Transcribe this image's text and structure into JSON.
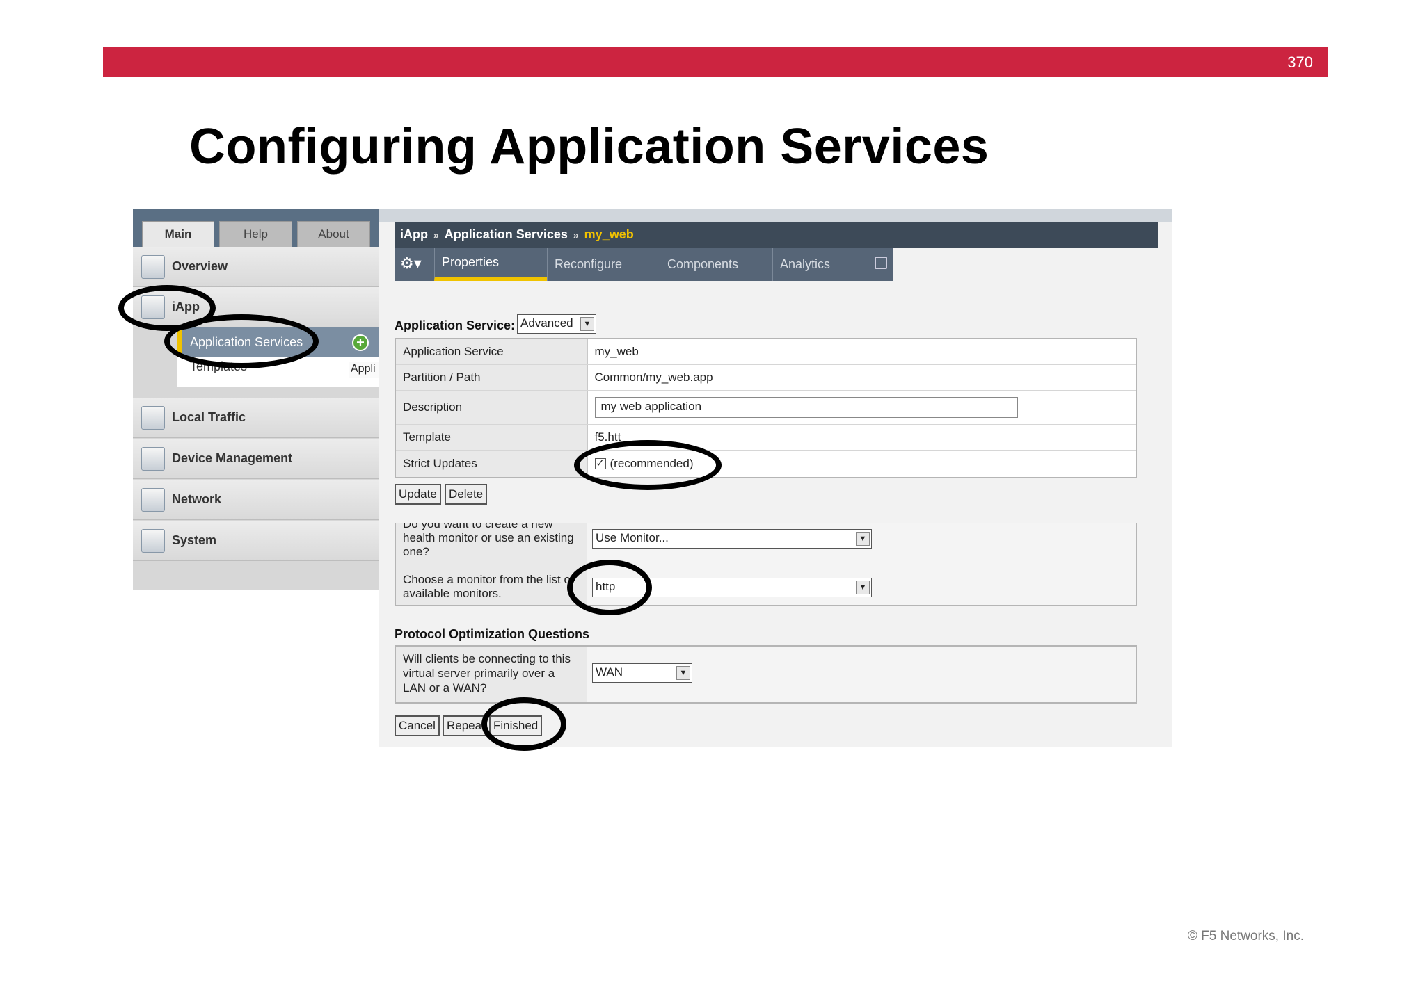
{
  "slide": {
    "number": "370",
    "title": "Configuring Application Services",
    "footer": "© F5 Networks, Inc."
  },
  "left_nav": {
    "tabs": [
      "Main",
      "Help",
      "About"
    ],
    "items": {
      "overview": "Overview",
      "iapp": "iApp",
      "local_traffic": "Local Traffic",
      "device_management": "Device Management",
      "network": "Network",
      "system": "System"
    },
    "submenu": {
      "application_services": "Application Services",
      "templates": "Templates",
      "add": "+",
      "appli": "Appli"
    }
  },
  "breadcrumb": {
    "root": "iApp",
    "section": "Application Services",
    "current": "my_web",
    "separator": "»"
  },
  "toolbar": {
    "tabs": [
      "Properties",
      "Reconfigure",
      "Components",
      "Analytics"
    ],
    "active": "Properties"
  },
  "form": {
    "app_service_label": "Application Service:",
    "app_service_mode": "Advanced",
    "rows": {
      "application_service": {
        "label": "Application Service",
        "value": "my_web"
      },
      "partition_path": {
        "label": "Partition / Path",
        "value": "Common/my_web.app"
      },
      "description": {
        "label": "Description",
        "value": "my web application"
      },
      "template": {
        "label": "Template",
        "value": "f5.htt"
      },
      "strict_updates": {
        "label": "Strict Updates",
        "value": "(recommended)",
        "checked": true
      }
    },
    "buttons": {
      "update": "Update",
      "delete": "Delete"
    },
    "monitor": {
      "q1_label": "Do you want to create a new health monitor or use an existing one?",
      "q1_value": "Use Monitor...",
      "q2_label": "Choose a monitor from the list of available monitors.",
      "q2_value": "http"
    },
    "protocol": {
      "title": "Protocol Optimization Questions",
      "q_label": "Will clients be connecting to this virtual server primarily over a LAN or a WAN?",
      "q_value": "WAN"
    },
    "footer_buttons": {
      "cancel": "Cancel",
      "repeat": "Repeat",
      "finished": "Finished"
    }
  },
  "colors": {
    "slide_bar": "#cc2440",
    "accent_yellow": "#f0c300",
    "header_dark": "#3d4a58"
  }
}
